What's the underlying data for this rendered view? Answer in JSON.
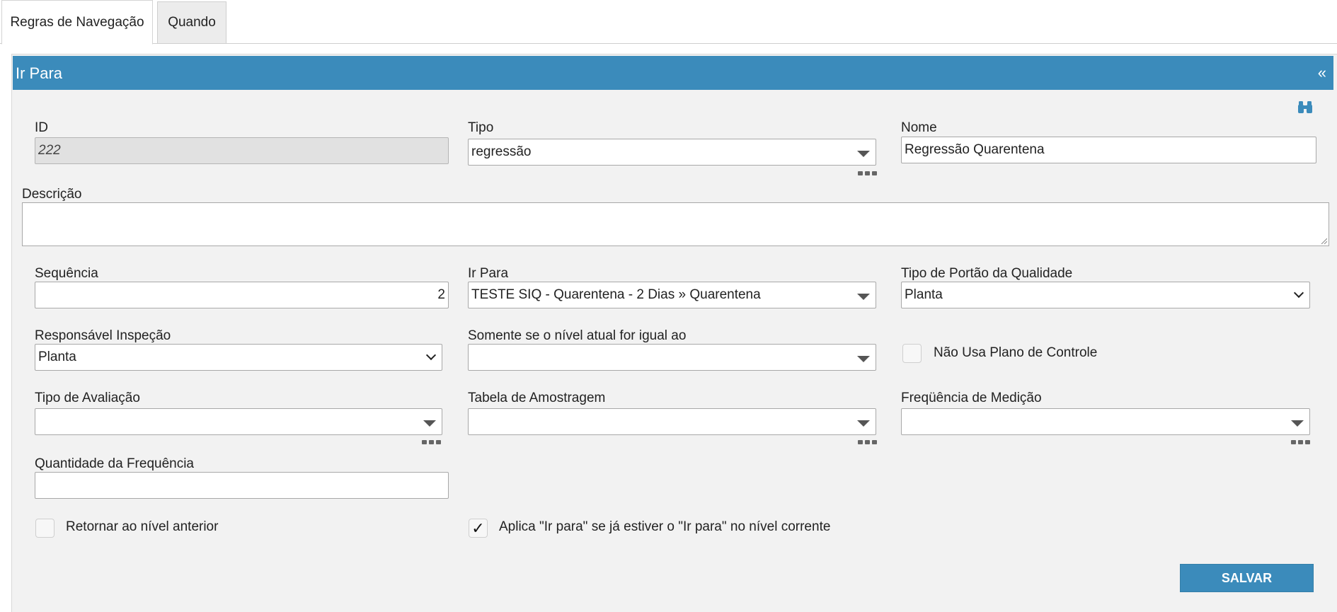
{
  "tabs": [
    {
      "label": "Regras de Navegação"
    },
    {
      "label": "Quando"
    }
  ],
  "panel": {
    "title": "Ir Para",
    "collapse_glyph": "«"
  },
  "fields": {
    "id": {
      "label": "ID",
      "value": "222"
    },
    "tipo": {
      "label": "Tipo",
      "value": "regressão"
    },
    "nome": {
      "label": "Nome",
      "value": "Regressão Quarentena"
    },
    "descricao": {
      "label": "Descrição",
      "value": ""
    },
    "sequencia": {
      "label": "Sequência",
      "value": "2"
    },
    "ir_para": {
      "label": "Ir Para",
      "value": "TESTE SIQ - Quarentena - 2 Dias » Quarentena"
    },
    "tipo_portao": {
      "label": "Tipo de Portão da Qualidade",
      "value": "Planta"
    },
    "responsavel": {
      "label": "Responsável Inspeção",
      "value": "Planta"
    },
    "somente_nivel": {
      "label": "Somente se o nível atual for igual ao",
      "value": ""
    },
    "nao_usa_plano": {
      "label": "Não Usa Plano de Controle",
      "checked": false
    },
    "tipo_avaliacao": {
      "label": "Tipo de Avaliação",
      "value": ""
    },
    "tabela_amostragem": {
      "label": "Tabela de Amostragem",
      "value": ""
    },
    "frequencia_medicao": {
      "label": "Freqüência de Medição",
      "value": ""
    },
    "quantidade_frequencia": {
      "label": "Quantidade da Frequência",
      "value": ""
    },
    "retornar_nivel": {
      "label": "Retornar ao nível anterior",
      "checked": false
    },
    "aplica_ir_para": {
      "label": "Aplica \"Ir para\" se já estiver o \"Ir para\" no nível corrente",
      "checked": true,
      "check_glyph": "✓"
    }
  },
  "buttons": {
    "save": "SALVAR"
  },
  "icons": {
    "search": "binoculars-icon"
  },
  "colors": {
    "header": "#3b8bbb",
    "button": "#3b8bbb",
    "panel_bg": "#f2f2f2"
  }
}
